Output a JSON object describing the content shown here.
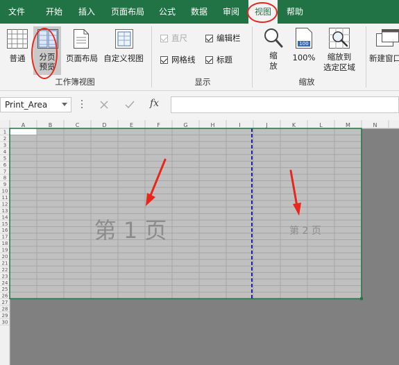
{
  "menu": {
    "items": [
      "文件",
      "开始",
      "插入",
      "页面布局",
      "公式",
      "数据",
      "审阅",
      "视图",
      "帮助"
    ],
    "active": "视图"
  },
  "ribbon": {
    "workbook_views": {
      "normal": "普通",
      "page_break_preview_line1": "分页",
      "page_break_preview_line2": "预览",
      "page_layout": "页面布局",
      "custom_views": "自定义视图",
      "group_label": "工作簿视图"
    },
    "show": {
      "ruler": "直尺",
      "ruler_checked": true,
      "formula_bar": "编辑栏",
      "formula_bar_checked": true,
      "gridlines": "网格线",
      "gridlines_checked": true,
      "headings": "标题",
      "headings_checked": true,
      "group_label": "显示"
    },
    "zoom": {
      "zoom": "缩放",
      "zoom_line1": "缩",
      "zoom_line2": "放",
      "hundred": "100%",
      "hundred_icon_text": "100",
      "zoom_to_selection_line1": "缩放到",
      "zoom_to_selection_line2": "选定区域",
      "group_label": "缩放"
    },
    "window": {
      "new_window": "新建窗口"
    }
  },
  "formula_bar": {
    "name_box": "Print_Area",
    "fx": "fx",
    "formula": ""
  },
  "sheet": {
    "columns": [
      "A",
      "B",
      "C",
      "D",
      "E",
      "F",
      "G",
      "H",
      "I",
      "J",
      "K",
      "L",
      "M",
      "N"
    ],
    "rows": [
      "1",
      "2",
      "3",
      "4",
      "5",
      "6",
      "7",
      "8",
      "9",
      "10",
      "11",
      "12",
      "13",
      "14",
      "15",
      "16",
      "17",
      "18",
      "19",
      "20",
      "21",
      "22",
      "23",
      "24",
      "25",
      "26",
      "27",
      "28",
      "29",
      "30"
    ],
    "page1_label": "第 1 页",
    "page2_label": "第 2 页"
  },
  "colors": {
    "menu_bg": "#217346",
    "annotation_red": "#e8261c",
    "page_break_line": "#1f1fa0",
    "print_area_border": "#217346"
  }
}
